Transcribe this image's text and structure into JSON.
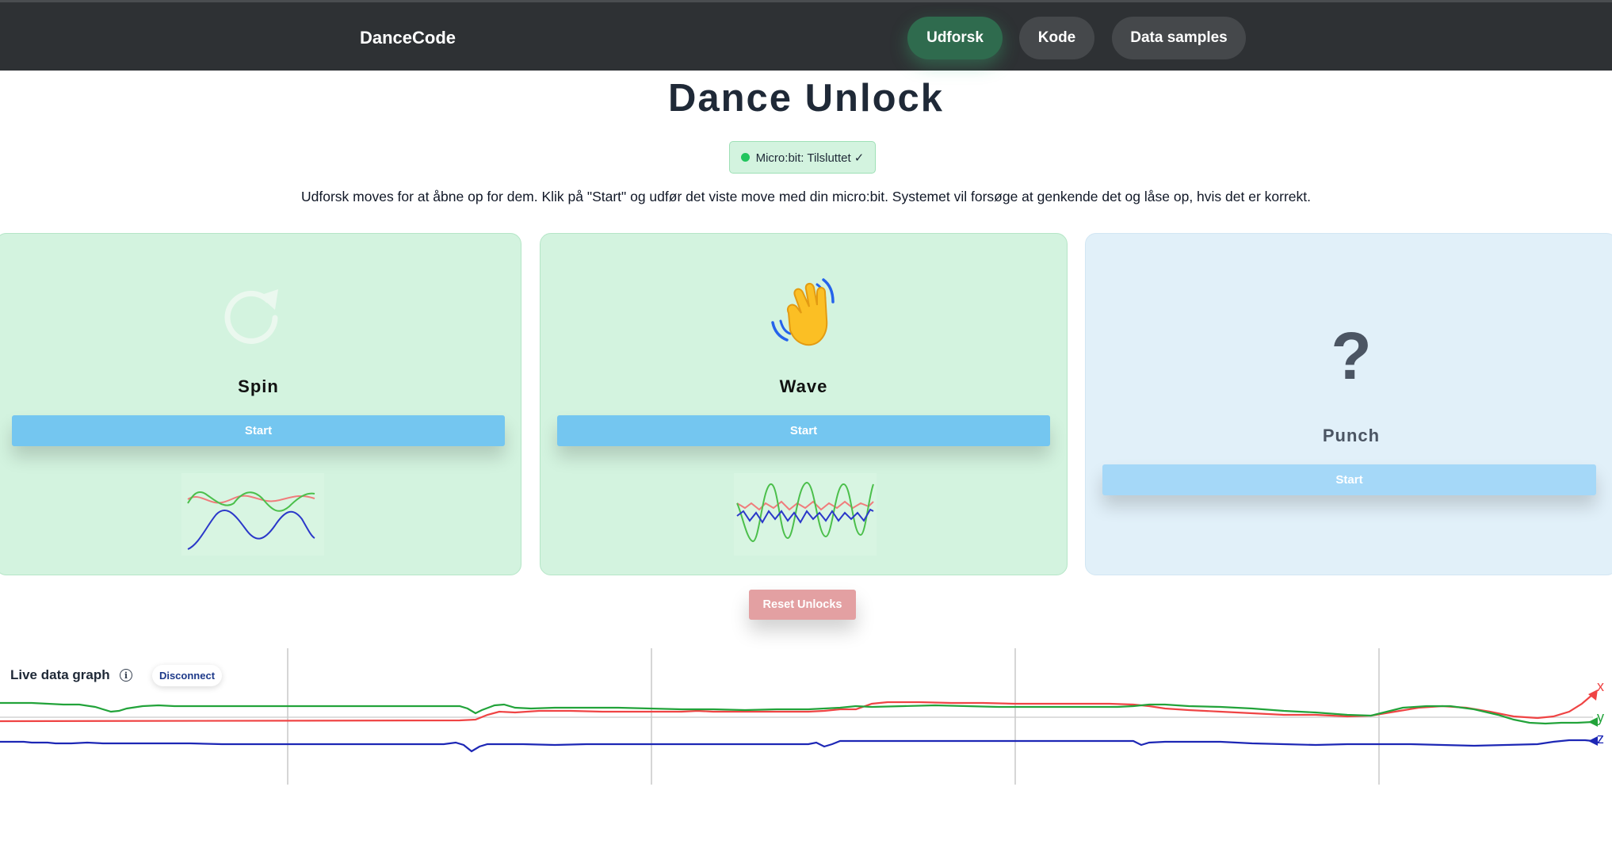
{
  "header": {
    "brand": "DanceCode",
    "nav": [
      {
        "label": "Udforsk",
        "active": true
      },
      {
        "label": "Kode",
        "active": false
      },
      {
        "label": "Data samples",
        "active": false
      }
    ]
  },
  "page": {
    "title": "Dance Unlock",
    "status": "Micro:bit: Tilsluttet ✓",
    "intro": "Udforsk moves for at åbne op for dem. Klik på \"Start\" og udfør det viste move med din micro:bit. Systemet vil forsøge at genkende det og låse op, hvis det er korrekt."
  },
  "moves": [
    {
      "name": "Spin",
      "icon": "spin-icon",
      "start_label": "Start",
      "unlocked": true
    },
    {
      "name": "Wave",
      "icon": "waving-hand-icon",
      "start_label": "Start",
      "unlocked": true
    },
    {
      "name": "Punch",
      "icon": "question-mark-icon",
      "icon_glyph": "?",
      "start_label": "Start",
      "unlocked": false
    }
  ],
  "reset_label": "Reset Unlocks",
  "live": {
    "label": "Live data graph",
    "disconnect_label": "Disconnect",
    "axes": [
      {
        "name": "x",
        "color": "#ef4444"
      },
      {
        "name": "y",
        "color": "#22a33a"
      },
      {
        "name": "z",
        "color": "#1d27b5"
      }
    ]
  },
  "colors": {
    "nav_bg": "#2e3134",
    "nav_active": "#2f6b4e",
    "card_unlocked": "#d3f3df",
    "card_locked": "#e1f0f9",
    "start_button": "#74c6f0",
    "reset_button": "#e3a0a2"
  }
}
